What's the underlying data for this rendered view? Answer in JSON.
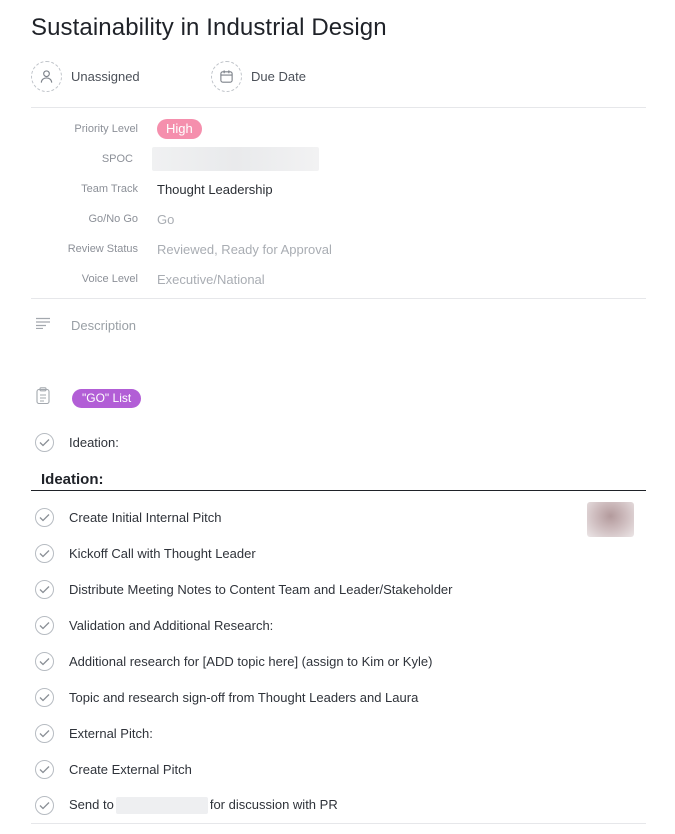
{
  "task": {
    "title": "Sustainability in Industrial Design",
    "assignee_label": "Unassigned",
    "due_label": "Due Date"
  },
  "fields": {
    "priority": {
      "label": "Priority Level",
      "value": "High",
      "color": "#f58fad"
    },
    "spoc": {
      "label": "SPOC"
    },
    "team_track": {
      "label": "Team Track",
      "value": "Thought Leadership"
    },
    "go_no_go": {
      "label": "Go/No Go",
      "value": "Go"
    },
    "review_status": {
      "label": "Review Status",
      "value": "Reviewed, Ready for Approval"
    },
    "voice_level": {
      "label": "Voice Level",
      "value": "Executive/National"
    }
  },
  "description": {
    "label": "Description"
  },
  "tag": {
    "label": "\"GO\" List",
    "color": "#b25ed6"
  },
  "checklist_top": {
    "label": "Ideation:"
  },
  "section": {
    "heading": "Ideation:"
  },
  "checklist": [
    {
      "label": "Create Initial Internal Pitch"
    },
    {
      "label": "Kickoff Call with Thought Leader"
    },
    {
      "label": "Distribute Meeting Notes to Content Team and Leader/Stakeholder"
    },
    {
      "label": "Validation and Additional Research:"
    },
    {
      "label": "Additional research for [ADD topic here] (assign to Kim or Kyle)"
    },
    {
      "label": "Topic and research sign-off from Thought Leaders and Laura"
    },
    {
      "label": "External Pitch:"
    },
    {
      "label": "Create External Pitch"
    }
  ],
  "last_item": {
    "prefix": "Send to",
    "suffix": "for discussion with PR"
  }
}
